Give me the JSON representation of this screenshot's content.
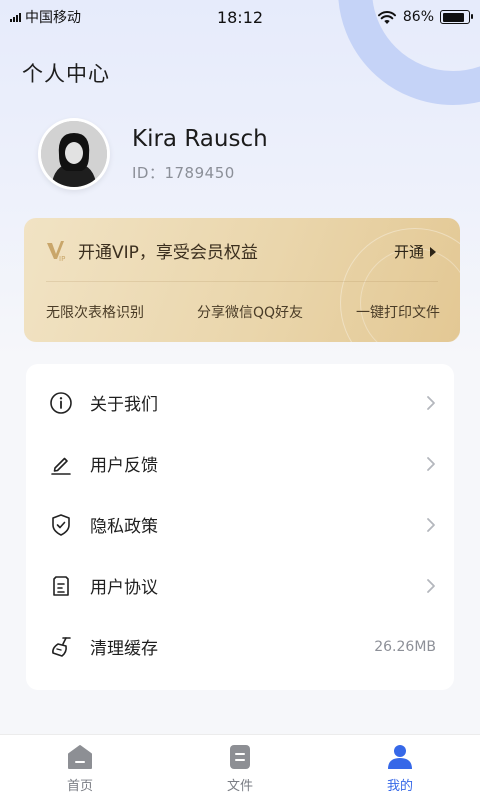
{
  "status_bar": {
    "carrier": "中国移动",
    "time": "18:12",
    "battery": "86%",
    "battery_level": 0.86
  },
  "page_title": "个人中心",
  "profile": {
    "name": "Kira Rausch",
    "id_text": "ID：1789450"
  },
  "vip": {
    "logo_text": "VIP",
    "title": "开通VIP，享受会员权益",
    "open_label": "开通",
    "features": [
      "无限次表格识别",
      "分享微信QQ好友",
      "一键打印文件"
    ]
  },
  "menu": [
    {
      "label": "关于我们",
      "icon": "info-icon"
    },
    {
      "label": "用户反馈",
      "icon": "pencil-icon"
    },
    {
      "label": "隐私政策",
      "icon": "shield-check-icon"
    },
    {
      "label": "用户协议",
      "icon": "document-icon"
    },
    {
      "label": "清理缓存",
      "icon": "broom-icon",
      "value": "26.26MB"
    }
  ],
  "tabbar": [
    {
      "label": "首页",
      "icon": "home-icon",
      "active": false
    },
    {
      "label": "文件",
      "icon": "file-icon",
      "active": false
    },
    {
      "label": "我的",
      "icon": "profile-icon",
      "active": true
    }
  ],
  "colors": {
    "accent": "#3668e8",
    "vip_gold": "#e3c894",
    "ring": "#c5d3f7"
  }
}
